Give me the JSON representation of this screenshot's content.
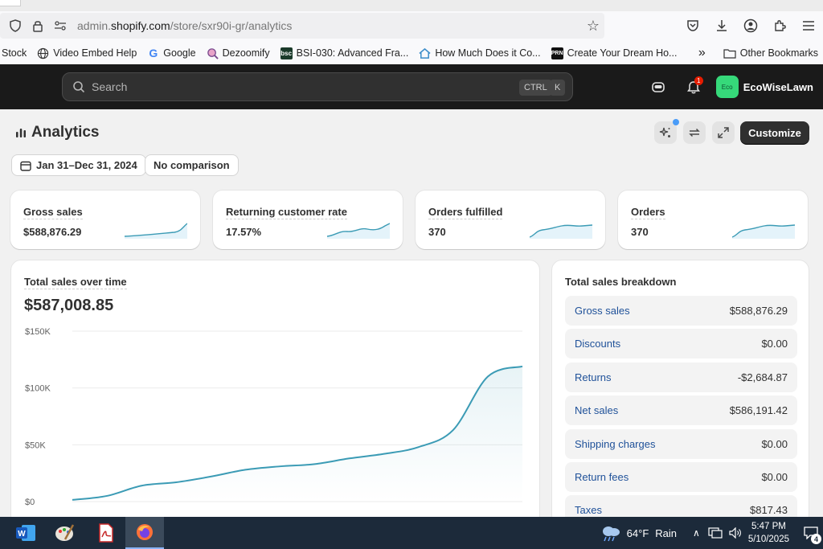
{
  "browser": {
    "url_prefix": "admin.",
    "url_domain": "shopify.com",
    "url_path": "/store/sxr90i-gr/analytics",
    "bookmarks": [
      {
        "label": "Stock",
        "icon": "none"
      },
      {
        "label": "Video Embed Help",
        "icon": "globe-icon"
      },
      {
        "label": "Google",
        "icon": "google-icon"
      },
      {
        "label": "Dezoomify",
        "icon": "dezoomify-icon"
      },
      {
        "label": "BSI-030: Advanced Fra...",
        "icon": "bsc-icon"
      },
      {
        "label": "How Much Does it Co...",
        "icon": "house-icon"
      },
      {
        "label": "Create Your Dream Ho...",
        "icon": "prn-icon"
      }
    ],
    "other_bookmarks": "Other Bookmarks"
  },
  "topbar": {
    "search_placeholder": "Search",
    "shortcut_ctrl": "CTRL",
    "shortcut_k": "K",
    "notification_count": "1",
    "avatar_text": "Eco",
    "store_name": "EcoWiseLawn"
  },
  "page": {
    "title": "Analytics",
    "customize_label": "Customize",
    "date_range": "Jan 31–Dec 31, 2024",
    "comparison": "No comparison"
  },
  "metrics": [
    {
      "label": "Gross sales",
      "value": "$588,876.29"
    },
    {
      "label": "Returning customer rate",
      "value": "17.57%"
    },
    {
      "label": "Orders fulfilled",
      "value": "370"
    },
    {
      "label": "Orders",
      "value": "370"
    }
  ],
  "sales_over_time": {
    "title": "Total sales over time",
    "total": "$587,008.85",
    "chart_data": {
      "type": "area",
      "title": "Total sales over time",
      "y_ticks": [
        "$150K",
        "$100K",
        "$50K",
        "$0"
      ],
      "ylim": [
        0,
        150000
      ],
      "values": [
        1500,
        5000,
        14000,
        17000,
        22000,
        28000,
        31000,
        33000,
        38000,
        42000,
        48000,
        63000,
        110000,
        119000
      ],
      "color": "#3b9bb5"
    }
  },
  "breakdown": {
    "title": "Total sales breakdown",
    "rows": [
      {
        "name": "Gross sales",
        "value": "$588,876.29"
      },
      {
        "name": "Discounts",
        "value": "$0.00"
      },
      {
        "name": "Returns",
        "value": "-$2,684.87"
      },
      {
        "name": "Net sales",
        "value": "$586,191.42"
      },
      {
        "name": "Shipping charges",
        "value": "$0.00"
      },
      {
        "name": "Return fees",
        "value": "$0.00"
      },
      {
        "name": "Taxes",
        "value": "$817.43"
      }
    ]
  },
  "taskbar": {
    "weather_temp": "64°F",
    "weather_text": "Rain",
    "time": "5:47 PM",
    "date": "5/10/2025",
    "notification_count": "4"
  }
}
